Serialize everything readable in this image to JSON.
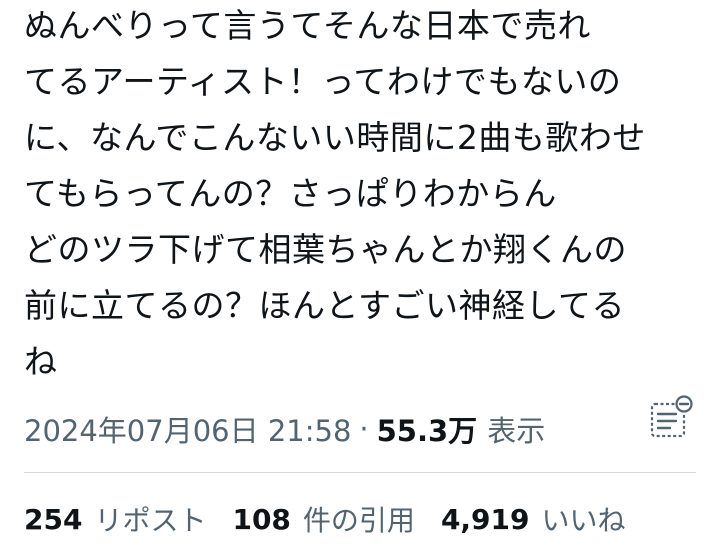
{
  "tweet": {
    "lines": [
      "ぬんべりって言うてそんな日本で売れ",
      "てるアーティスト！ってわけでもないの",
      "に、なんでこんないい時間に2曲も歌わせ",
      "てもらってんの？さっぱりわからん",
      "どのツラ下げて相葉ちゃんとか翔くんの",
      "前に立てるの？ほんとすごい神経してる",
      "ね"
    ]
  },
  "meta": {
    "timestamp": "2024年07月06日 21:58",
    "separator": "·",
    "views_count": "55.3万",
    "views_label": "表示"
  },
  "stats": {
    "reposts": {
      "count": "254",
      "label": "リポスト"
    },
    "quotes": {
      "count": "108",
      "label": "件の引用"
    },
    "likes": {
      "count": "4,919",
      "label": "いいね"
    }
  },
  "icons": {
    "analytics": "analytics-icon"
  },
  "colors": {
    "text_primary": "#0f1419",
    "text_secondary": "#536471",
    "divider": "#cfd9de"
  }
}
